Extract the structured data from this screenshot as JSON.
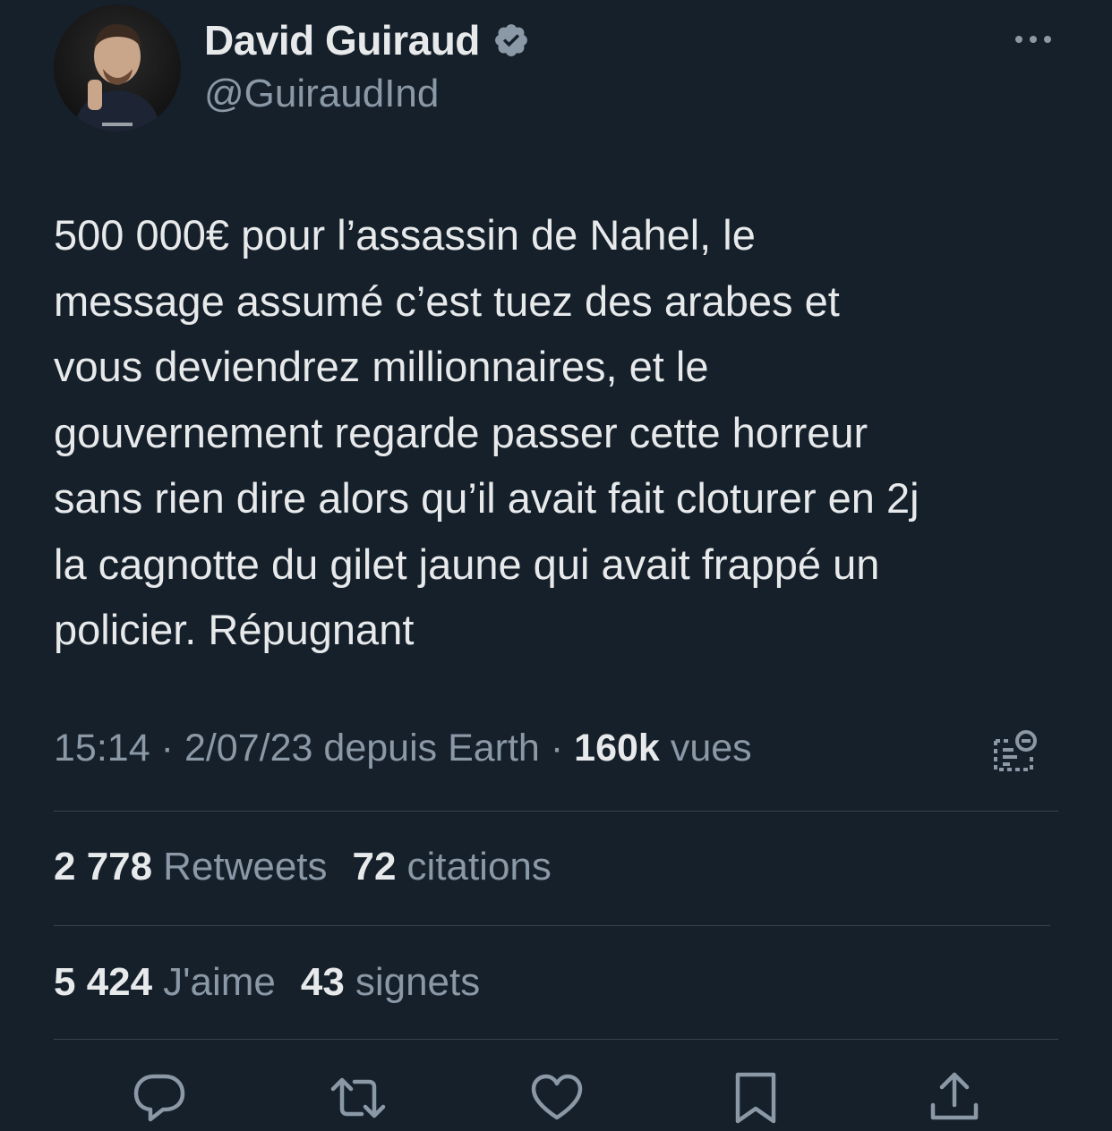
{
  "author": {
    "display_name": "David Guiraud",
    "handle": "@GuiraudInd",
    "verified": true,
    "avatar_icon": "profile-photo"
  },
  "tweet": {
    "text": "500 000€ pour l’assassin de Nahel, le\nmessage assumé c’est tuez des arabes et\nvous deviendrez millionnaires, et le\ngouvernement regarde passer cette horreur\nsans rien dire alors qu’il avait fait cloturer en 2j\nla cagnotte du gilet jaune qui avait frappé un\npolicier. Répugnant",
    "time": "15:14",
    "date": "2/07/23",
    "source": "depuis Earth",
    "views_count": "160k",
    "views_label": "vues",
    "separator": "·"
  },
  "stats": {
    "retweets_count": "2 778",
    "retweets_label": "Retweets",
    "quotes_count": "72",
    "quotes_label": "citations",
    "likes_count": "5 424",
    "likes_label": "J'aime",
    "bookmarks_count": "43",
    "bookmarks_label": "signets"
  },
  "icons": {
    "verified": "verified-badge-icon",
    "more": "more-options-icon",
    "analytics": "analytics-icon",
    "reply": "reply-icon",
    "retweet": "retweet-icon",
    "like": "heart-icon",
    "bookmark": "bookmark-icon",
    "share": "share-icon"
  },
  "colors": {
    "background": "#15202b",
    "text_primary": "#e7e9ea",
    "text_secondary": "#8b98a5",
    "divider": "#38444d",
    "verified_badge": "#8b98a5"
  }
}
